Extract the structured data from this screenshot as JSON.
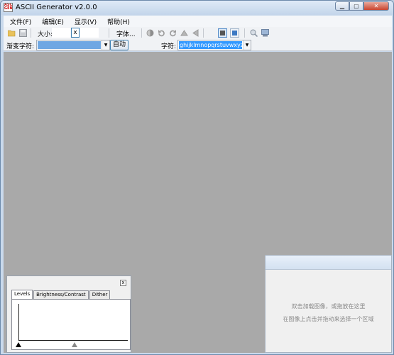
{
  "window": {
    "title": "ASCII Generator v2.0.0",
    "app_icon_text": "ASC GEN"
  },
  "menu": [
    "文件(F)",
    "编辑(E)",
    "显示(V)",
    "帮助(H)"
  ],
  "toolbar": {
    "size_label": "大小:",
    "width_value": "",
    "height_value": "",
    "size_separator": "x",
    "font_button": "字体...",
    "gradient_label": "渐变字符:",
    "gradient_value": "",
    "auto_button": "自动",
    "chars_label": "字符:",
    "chars_value": "ghijklmnopqrstuvwxyz$"
  },
  "levels_panel": {
    "close_label": "x",
    "tabs": [
      "Levels",
      "Brightness/Contrast",
      "Dither"
    ],
    "active_tab": "Levels"
  },
  "preview_panel": {
    "hint_line1": "双击加载图像，或拖放在这里",
    "hint_line2": "在图像上点击并拖动来选择一个区域"
  },
  "colors": {
    "workspace": "#a9a9a9",
    "selection": "#3399ff"
  }
}
